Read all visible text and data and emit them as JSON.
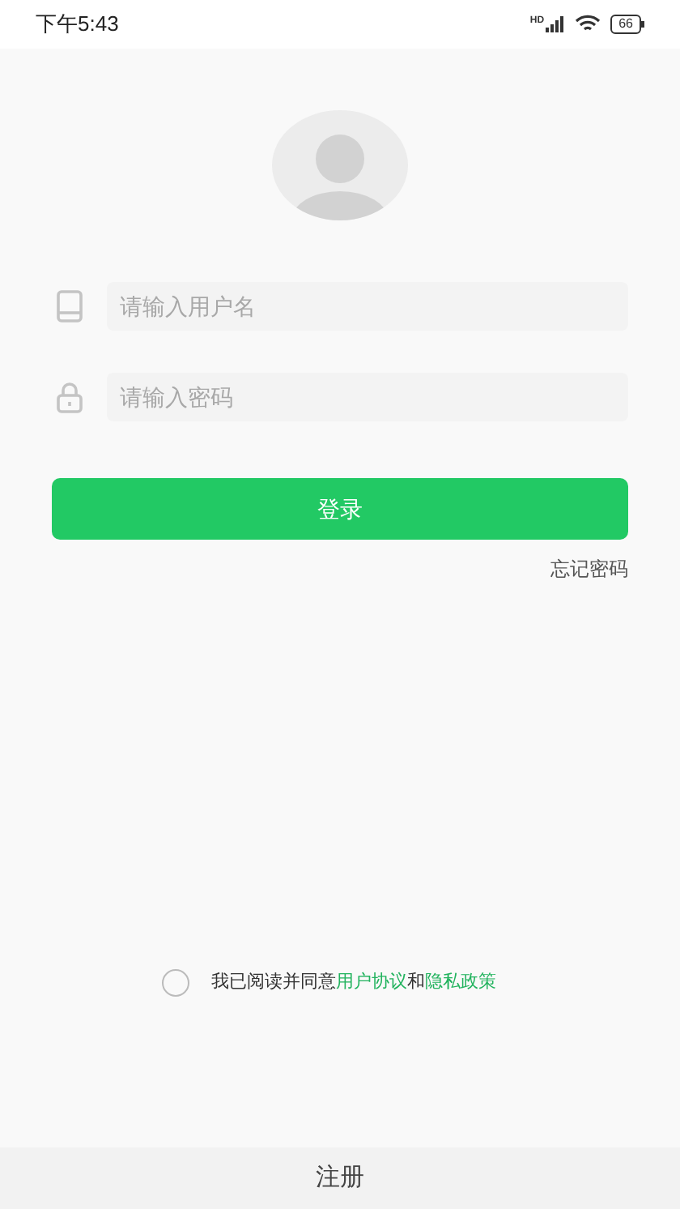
{
  "status_bar": {
    "time": "下午5:43",
    "signal_label": "HD",
    "battery": "66"
  },
  "fields": [
    {
      "kind": "phone",
      "placeholder": "请输入用户名"
    },
    {
      "kind": "lock",
      "placeholder": "请输入密码"
    }
  ],
  "login_button": "登录",
  "forgot_password": "忘记密码",
  "agreement": {
    "checked": false,
    "prefix": "我已阅读并同意",
    "links": [
      "用户协议",
      "隐私政策"
    ],
    "joiner": "和"
  },
  "register": "注册"
}
